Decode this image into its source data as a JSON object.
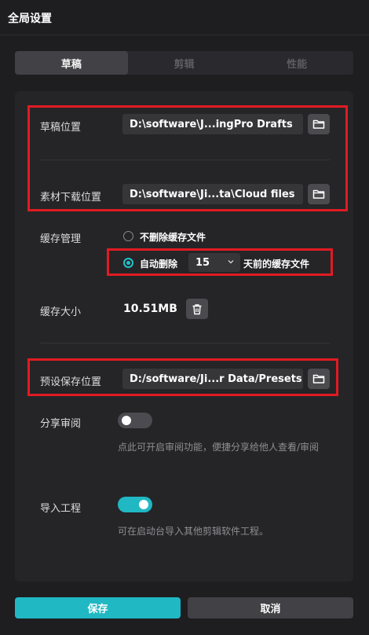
{
  "window": {
    "title": "全局设置"
  },
  "tabs": [
    {
      "label": "草稿",
      "active": true
    },
    {
      "label": "剪辑",
      "active": false
    },
    {
      "label": "性能",
      "active": false
    }
  ],
  "draft_location": {
    "label": "草稿位置",
    "value": "D:\\software\\J...ingPro Drafts"
  },
  "material_location": {
    "label": "素材下载位置",
    "value": "D:\\software\\Ji...ta\\Cloud files"
  },
  "cache_management": {
    "label": "缓存管理",
    "option_keep": "不删除缓存文件",
    "option_auto": "自动删除",
    "selected": "自动删除",
    "days_value": "15",
    "days_suffix": "天前的缓存文件"
  },
  "cache_size": {
    "label": "缓存大小",
    "value": "10.51MB"
  },
  "preset_location": {
    "label": "预设保存位置",
    "value": "D:/software/Ji...r Data/Presets"
  },
  "share_review": {
    "label": "分享审阅",
    "enabled": false,
    "hint": "点此可开启审阅功能，便捷分享给他人查看/审阅"
  },
  "import_project": {
    "label": "导入工程",
    "enabled": true,
    "hint": "可在启动台导入其他剪辑软件工程。"
  },
  "footer": {
    "save_label": "保存",
    "cancel_label": "取消"
  },
  "colors": {
    "accent": "#1fb8c3",
    "highlight": "#e11b22",
    "background": "#1e1e21"
  },
  "icons": {
    "folder": "folder-icon",
    "trash": "trash-icon",
    "chevron": "chevron-down-icon"
  }
}
